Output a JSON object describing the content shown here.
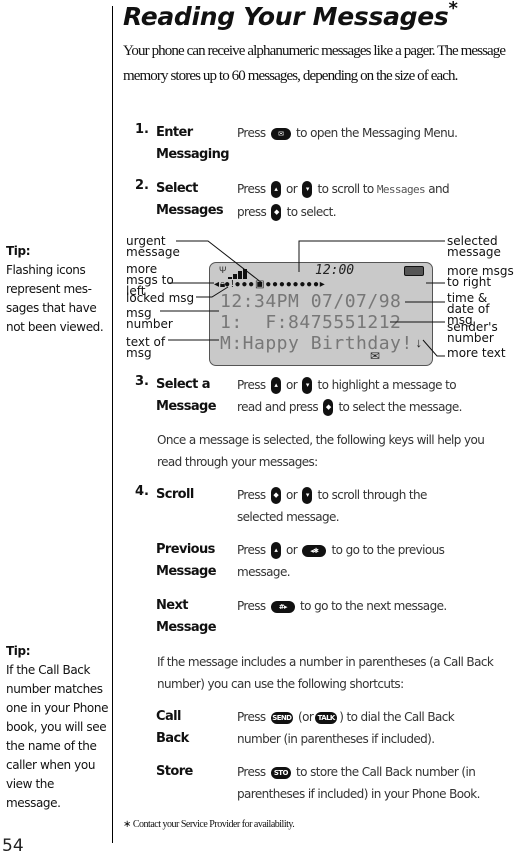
{
  "page": {
    "title": "Reading Your Messages",
    "title_mark": "*",
    "page_number": "54",
    "intro": "Your phone can receive alphanumeric messages like a pager. The message memory stores up to 60 messages, depending on the size of each.",
    "footnote": "∗ Contact your Service Provider for availability."
  },
  "tips": [
    {
      "label": "Tip:",
      "text": "Flashing icons represent mes-sages that have not been viewed."
    },
    {
      "label": "Tip:",
      "text": "If the Call Back number matches one in your Phone book, you will see the name of the caller when you view the message."
    }
  ],
  "steps": [
    {
      "num": "1.",
      "label1": "Enter",
      "label2": "Messaging",
      "pre": "Press",
      "post": "to open the Messaging Menu.",
      "key": "message-key"
    },
    {
      "num": "2.",
      "label1": "Select",
      "label2": "Messages",
      "line1_pre": "Press",
      "line1_mid": "or",
      "line1_post": "to scroll to",
      "menu_item": "Messages",
      "line1_end": "and",
      "line2_pre": "press",
      "line2_post": "to select."
    },
    {
      "num": "3.",
      "label1": "Select a",
      "label2": "Message",
      "line1_pre": "Press",
      "line1_mid": "or",
      "line1_post": "to highlight a message to",
      "line2_pre": "read and press",
      "line2_post": "to select the message."
    },
    {
      "num": "4.",
      "label1": "Scroll",
      "line1_pre": "Press",
      "line1_mid": "or",
      "line1_post": "to scroll through the",
      "line2": "selected message."
    }
  ],
  "once_selected": "Once a message is selected, the following keys will help you read through your messages:",
  "previous": {
    "label1": "Previous",
    "label2": "Message",
    "pre": "Press",
    "mid": "or",
    "key": "◂✱",
    "post": "to go to the previous",
    "line2": "message."
  },
  "next": {
    "label1": "Next",
    "label2": "Message",
    "pre": "Press",
    "key": "#▸",
    "post": "to go to the next message."
  },
  "callback_intro": "If the message includes a number in parentheses (a Call Back number) you can use the following shortcuts:",
  "call_back": {
    "label": "Call Back",
    "pre": "Press",
    "key1": "SEND",
    "mid": "(or",
    "key2": "TALK",
    "post": ") to dial the Call Back",
    "line2": "number (in parentheses if included)."
  },
  "store": {
    "label": "Store",
    "pre": "Press",
    "key": "STO",
    "post": "to store the Call Back number (in",
    "line2": "parentheses if included) in your Phone Book."
  },
  "display": {
    "clock": "12:00",
    "line1": "12:34PM 07/07/98",
    "line2": "1:  F:8475551212",
    "line3": "M:Happy Birthday!",
    "more_text_glyph": "↓",
    "labels_left": [
      "urgent message",
      "more msgs to left",
      "locked msg",
      "msg number",
      "text of msg"
    ],
    "labels_right": [
      "selected message",
      "more msgs to right",
      "time & date of msg",
      "sender's number",
      "more text"
    ]
  }
}
